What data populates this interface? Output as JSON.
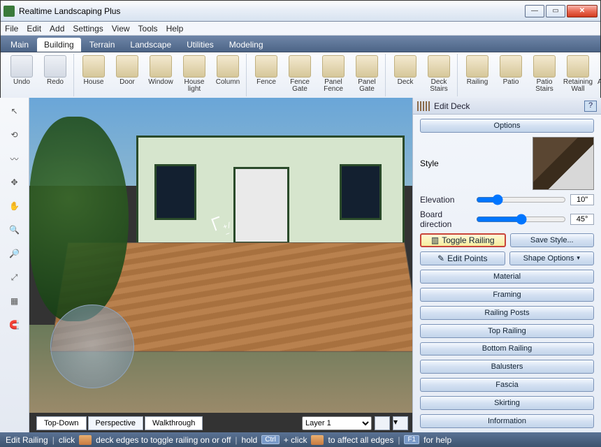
{
  "window": {
    "title": "Realtime Landscaping Plus"
  },
  "menu": [
    "File",
    "Edit",
    "Add",
    "Settings",
    "View",
    "Tools",
    "Help"
  ],
  "tabs": [
    "Main",
    "Building",
    "Terrain",
    "Landscape",
    "Utilities",
    "Modeling"
  ],
  "active_tab": "Building",
  "ribbon": [
    {
      "label": "Undo",
      "gray": true
    },
    {
      "label": "Redo",
      "gray": true
    },
    {
      "label": "House"
    },
    {
      "label": "Door"
    },
    {
      "label": "Window"
    },
    {
      "label": "House light"
    },
    {
      "label": "Column"
    },
    {
      "label": "Fence"
    },
    {
      "label": "Fence Gate"
    },
    {
      "label": "Panel Fence"
    },
    {
      "label": "Panel Gate"
    },
    {
      "label": "Deck"
    },
    {
      "label": "Deck Stairs"
    },
    {
      "label": "Railing"
    },
    {
      "label": "Patio"
    },
    {
      "label": "Patio Stairs"
    },
    {
      "label": "Retaining Wall"
    },
    {
      "label": "Acce Stri"
    }
  ],
  "viewtabs": [
    "Top-Down",
    "Perspective",
    "Walkthrough"
  ],
  "active_viewtab": "Perspective",
  "layer": "Layer 1",
  "panel": {
    "title": "Edit Deck",
    "options_label": "Options",
    "style_label": "Style",
    "elevation_label": "Elevation",
    "elevation_value": "10\"",
    "board_label": "Board direction",
    "board_value": "45°",
    "toggle_railing": "Toggle Railing",
    "save_style": "Save Style...",
    "edit_points": "Edit Points",
    "shape_options": "Shape Options",
    "sections": [
      "Material",
      "Framing",
      "Railing Posts",
      "Top Railing",
      "Bottom Railing",
      "Balusters",
      "Fascia",
      "Skirting",
      "Information"
    ]
  },
  "status": {
    "mode": "Edit Railing",
    "seg1": "click",
    "seg2": "deck edges to toggle railing on or off",
    "seg3": "hold",
    "ctrl": "Ctrl",
    "seg4": "+ click",
    "seg5": "to affect all edges",
    "f1": "F1",
    "seg6": "for help"
  }
}
